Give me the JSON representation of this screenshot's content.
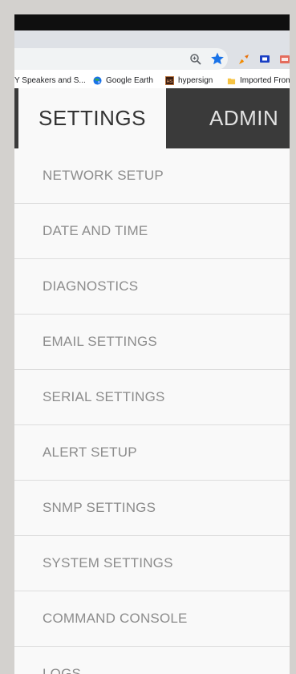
{
  "bookmarks": [
    {
      "label": "Y Speakers and S...",
      "icon": "bookmark-page-icon"
    },
    {
      "label": "Google Earth",
      "icon": "google-earth-icon"
    },
    {
      "label": "hypersign",
      "icon": "hypersign-icon"
    },
    {
      "label": "Imported From",
      "icon": "folder-icon"
    }
  ],
  "tabs": {
    "settings": "SETTINGS",
    "admin": "ADMIN"
  },
  "menu": {
    "items": [
      "NETWORK SETUP",
      "DATE AND TIME",
      "DIAGNOSTICS",
      "EMAIL SETTINGS",
      "SERIAL SETTINGS",
      "ALERT SETUP",
      "SNMP SETTINGS",
      "SYSTEM SETTINGS",
      "COMMAND CONSOLE",
      "LOGS"
    ]
  },
  "colors": {
    "nav_bar": "#3a3a3a",
    "active_tab": "#f9f9f9",
    "menu_text": "#8c8c8c",
    "star": "#1a73e8"
  }
}
